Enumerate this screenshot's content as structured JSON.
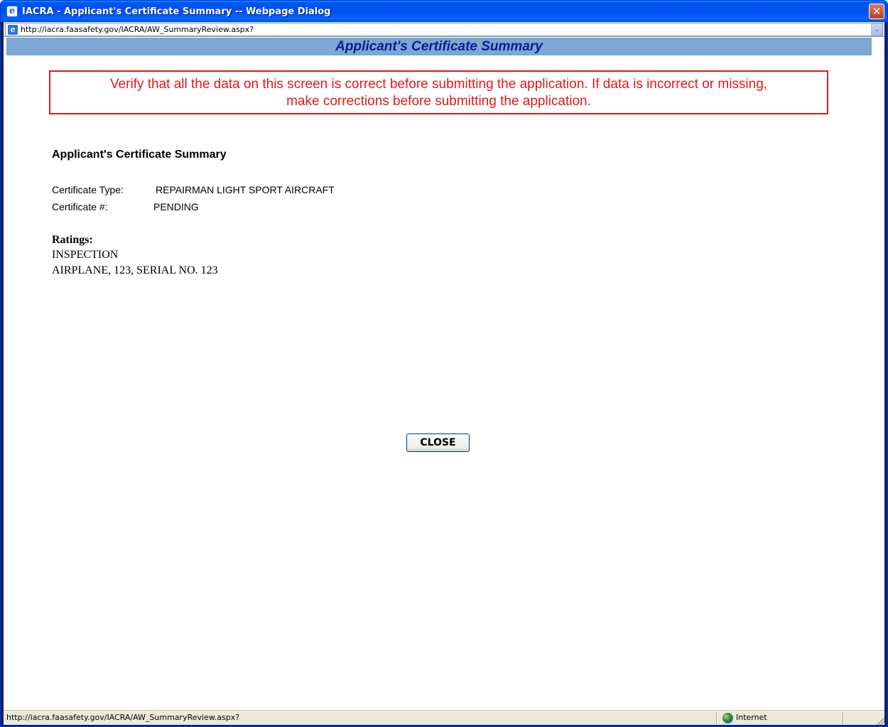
{
  "window": {
    "title": "IACRA - Applicant's Certificate Summary -- Webpage Dialog",
    "close_glyph": "✕"
  },
  "address": {
    "url": "http://iacra.faasafety.gov/IACRA/AW_SummaryReview.aspx?",
    "dropdown_glyph": "⌄"
  },
  "header": {
    "title": "Applicant's Certificate Summary"
  },
  "warning": {
    "line1": "Verify that all the data on this screen is correct before submitting the application. If data is incorrect or missing,",
    "line2": "make corrections before submitting the application."
  },
  "summary": {
    "title": "Applicant's Certificate Summary",
    "fields": [
      {
        "label": "Certificate Type:",
        "value": "REPAIRMAN LIGHT SPORT AIRCRAFT"
      },
      {
        "label": "Certificate #:",
        "value": "PENDING"
      }
    ]
  },
  "ratings": {
    "label": "Ratings:",
    "items": [
      "INSPECTION",
      "AIRPLANE, 123, SERIAL NO. 123"
    ]
  },
  "actions": {
    "close_label": "CLOSE"
  },
  "statusbar": {
    "url": "http://iacra.faasafety.gov/IACRA/AW_SummaryReview.aspx?",
    "zone": "Internet"
  },
  "icons": {
    "title_icon": "ie-icon",
    "address_icon": "page-icon",
    "zone_icon": "globe-icon"
  },
  "colors": {
    "warning": "#e01919",
    "header_bar": "#7ba7d7",
    "header_text": "#0a1e8c",
    "titlebar": "#0053ee"
  }
}
